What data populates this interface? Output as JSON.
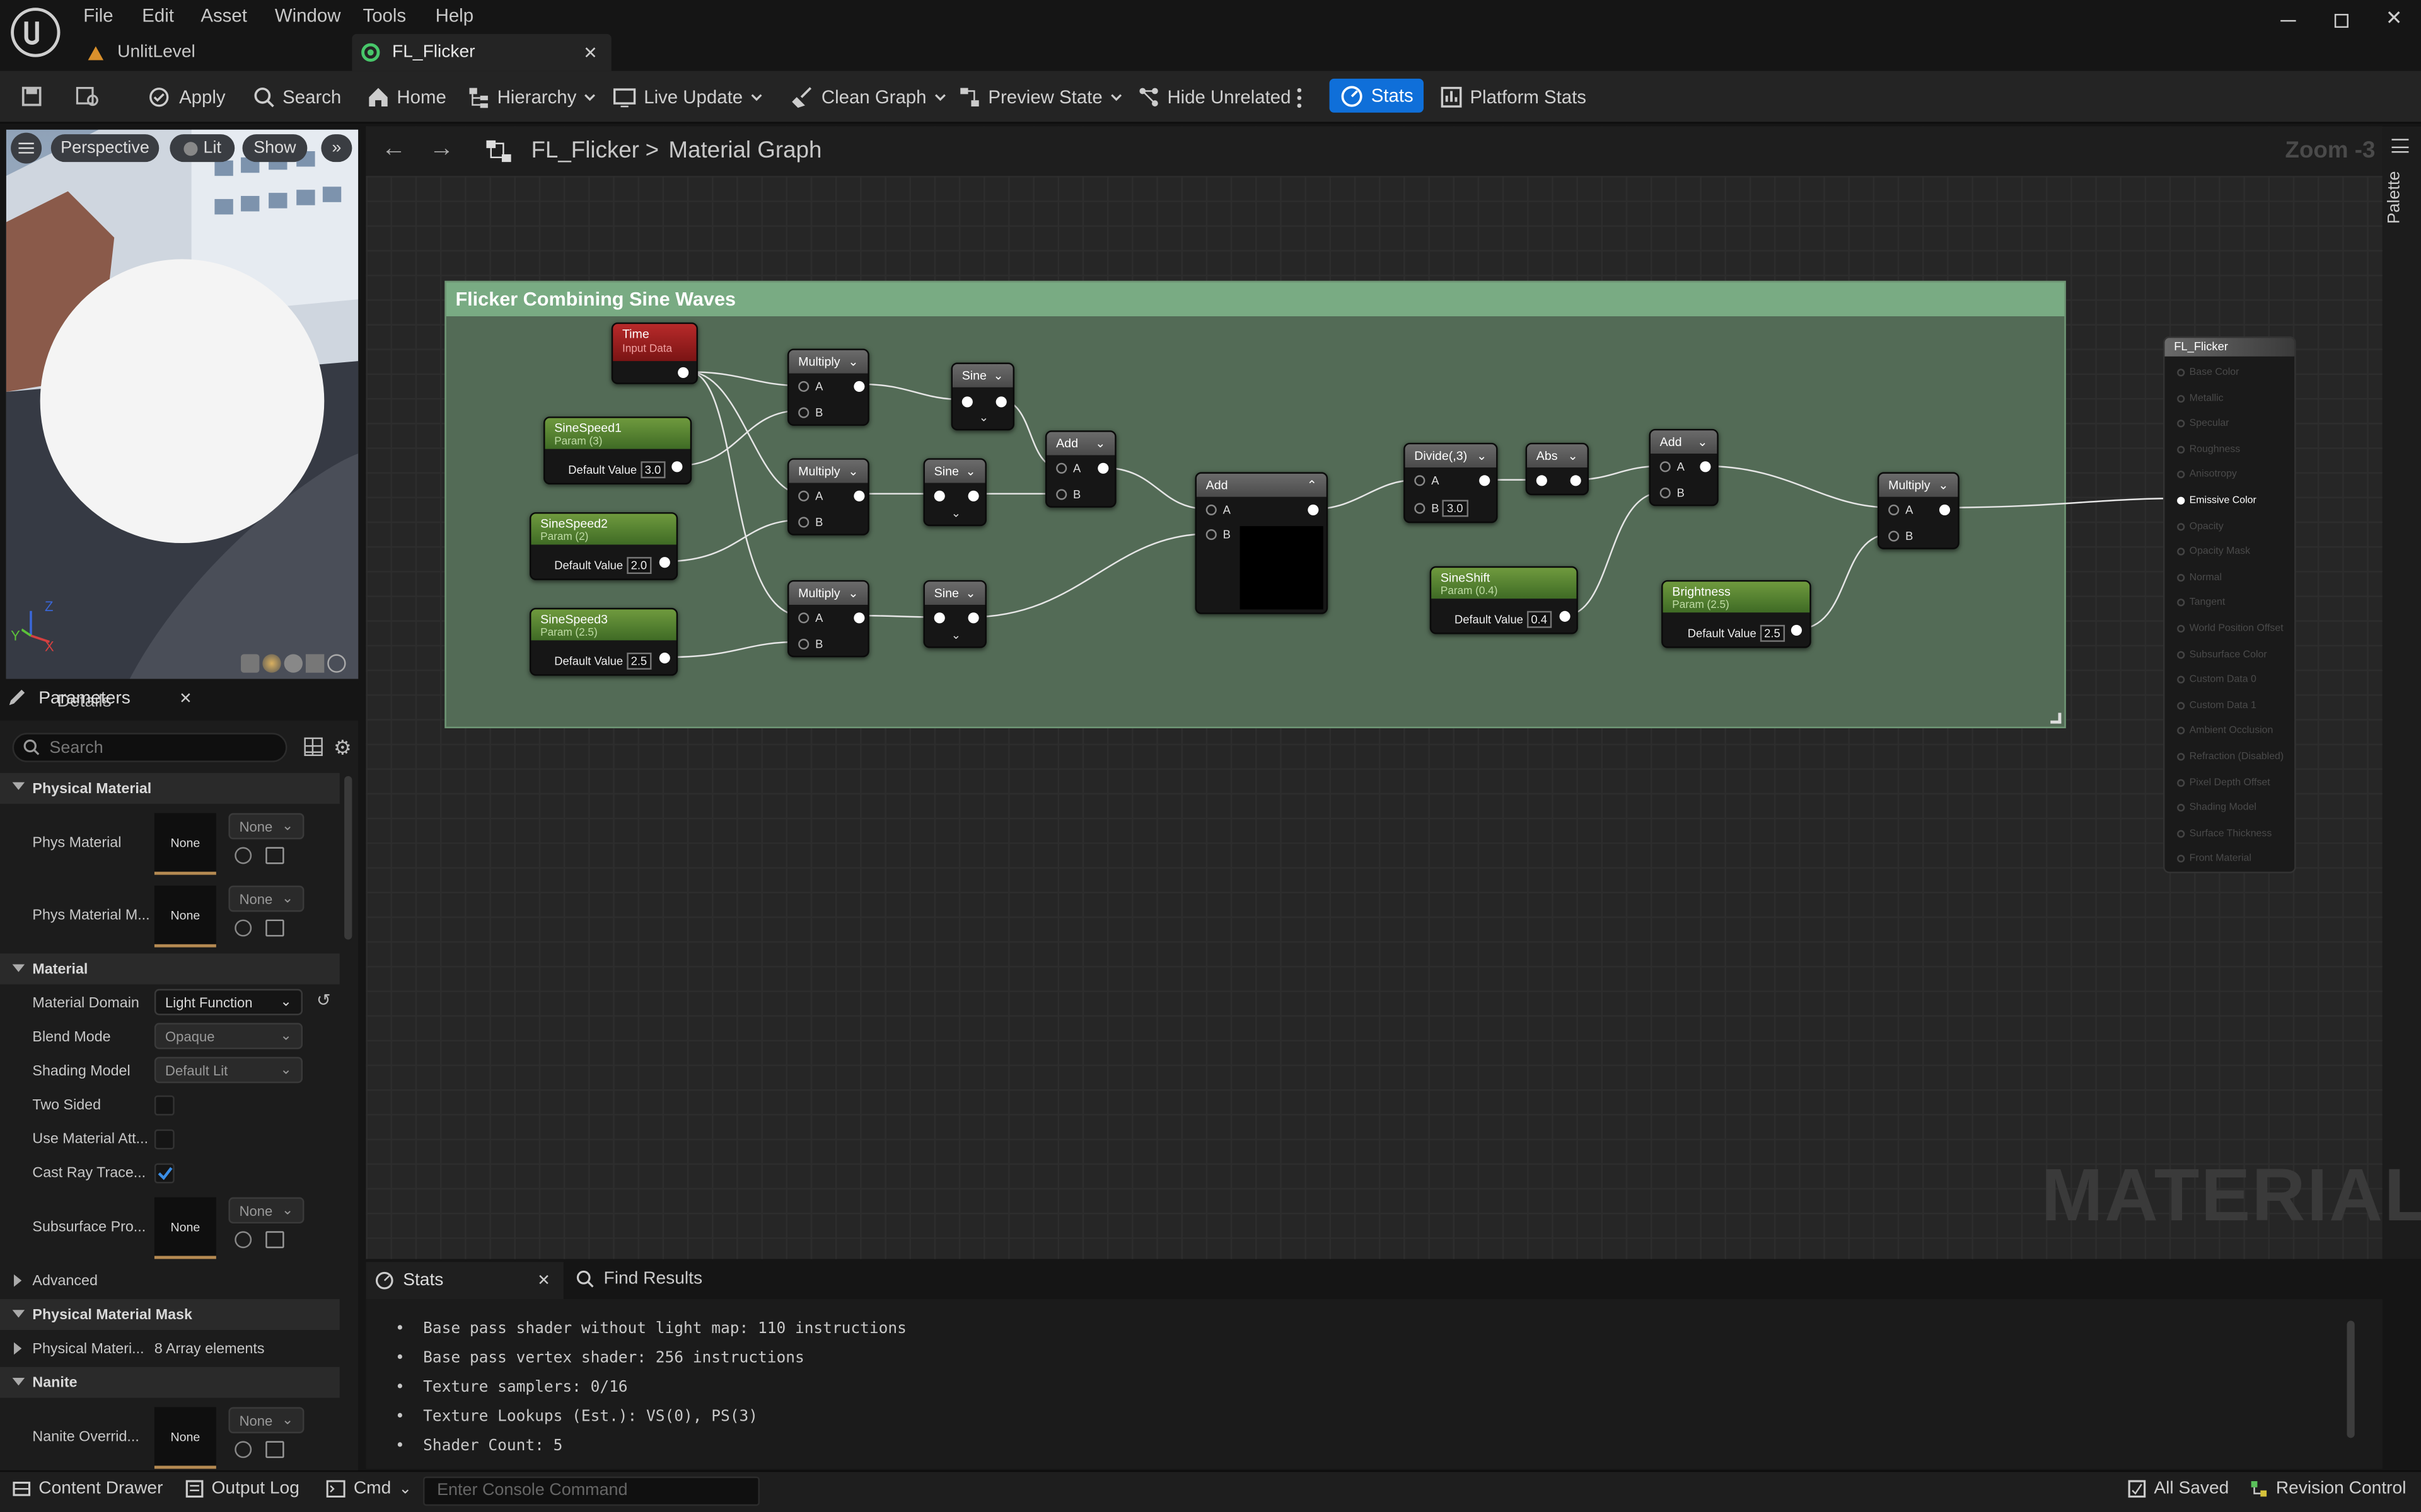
{
  "menu": [
    "File",
    "Edit",
    "Asset",
    "Window",
    "Tools",
    "Help"
  ],
  "tabs": [
    {
      "label": "UnlitLevel"
    },
    {
      "label": "FL_Flicker"
    }
  ],
  "toolbar": {
    "apply": "Apply",
    "search": "Search",
    "home": "Home",
    "hierarchy": "Hierarchy",
    "live_update": "Live Update",
    "clean_graph": "Clean Graph",
    "preview_state": "Preview State",
    "hide_unrelated": "Hide Unrelated",
    "stats": "Stats",
    "platform_stats": "Platform Stats"
  },
  "viewport": {
    "perspective": "Perspective",
    "lit": "Lit",
    "show": "Show",
    "axis_z": "Z",
    "axis_y": "Y",
    "axis_x": "X"
  },
  "graph": {
    "breadcrumb_asset": "FL_Flicker",
    "breadcrumb_sep": ">",
    "breadcrumb_graph": "Material Graph",
    "zoom": "Zoom -3",
    "palette": "Palette",
    "watermark": "MATERIAL",
    "comment": "Flicker Combining Sine Waves",
    "nodes": {
      "time": {
        "title": "Time",
        "sub": "Input Data"
      },
      "speed1": {
        "title": "SineSpeed1",
        "sub": "Param (3)",
        "dv_label": "Default Value",
        "dv": "3.0"
      },
      "speed2": {
        "title": "SineSpeed2",
        "sub": "Param (2)",
        "dv_label": "Default Value",
        "dv": "2.0"
      },
      "speed3": {
        "title": "SineSpeed3",
        "sub": "Param (2.5)",
        "dv_label": "Default Value",
        "dv": "2.5"
      },
      "mul1": "Multiply",
      "mul2": "Multiply",
      "mul3": "Multiply",
      "sine1": "Sine",
      "sine2": "Sine",
      "sine3": "Sine",
      "add1": "Add",
      "add2": "Add",
      "add3": "Add",
      "divide": {
        "title": "Divide(,3)",
        "b": "3.0"
      },
      "abs": "Abs",
      "shift": {
        "title": "SineShift",
        "sub": "Param (0.4)",
        "dv_label": "Default Value",
        "dv": "0.4"
      },
      "bright": {
        "title": "Brightness",
        "sub": "Param (2.5)",
        "dv_label": "Default Value",
        "dv": "2.5"
      },
      "mul4": "Multiply",
      "pin_a": "A",
      "pin_b": "B"
    },
    "result": {
      "title": "FL_Flicker",
      "pins": [
        "Base Color",
        "Metallic",
        "Specular",
        "Roughness",
        "Anisotropy",
        "Emissive Color",
        "Opacity",
        "Opacity Mask",
        "Normal",
        "Tangent",
        "World Position Offset",
        "Subsurface Color",
        "Custom Data 0",
        "Custom Data 1",
        "Ambient Occlusion",
        "Refraction (Disabled)",
        "Pixel Depth Offset",
        "Shading Model",
        "Surface Thickness",
        "Front Material"
      ]
    }
  },
  "details": {
    "tab_params": "Parameters",
    "tab_details": "Details",
    "search_placeholder": "Search",
    "sec_physical": "Physical Material",
    "phys_material": "Phys Material",
    "phys_material_mask": "Phys Material M...",
    "none": "None",
    "sec_material": "Material",
    "material_domain": "Material Domain",
    "material_domain_val": "Light Function",
    "blend_mode": "Blend Mode",
    "blend_mode_val": "Opaque",
    "shading_model": "Shading Model",
    "shading_model_val": "Default Lit",
    "two_sided": "Two Sided",
    "use_material_att": "Use Material Att...",
    "cast_ray": "Cast Ray Trace...",
    "subsurface": "Subsurface Pro...",
    "advanced": "Advanced",
    "sec_pmm": "Physical Material Mask",
    "physical_materi": "Physical Materi...",
    "array": "8 Array elements",
    "sec_nanite": "Nanite",
    "nanite_override": "Nanite Overrid..."
  },
  "stats": {
    "tab_stats": "Stats",
    "tab_find": "Find Results",
    "lines": [
      "Base pass shader without light map: 110 instructions",
      "Base pass vertex shader: 256 instructions",
      "Texture samplers: 0/16",
      "Texture Lookups (Est.): VS(0), PS(3)",
      "Shader Count: 5"
    ]
  },
  "statusbar": {
    "content_drawer": "Content Drawer",
    "output_log": "Output Log",
    "cmd": "Cmd",
    "console_placeholder": "Enter Console Command",
    "all_saved": "All Saved",
    "revision": "Revision Control"
  },
  "colors": {
    "accent": "#0f6fd9",
    "comment_header": "#79ab83",
    "comment_body": "#536b56",
    "param_green": "#5c8a35",
    "time_red": "#a82222"
  }
}
